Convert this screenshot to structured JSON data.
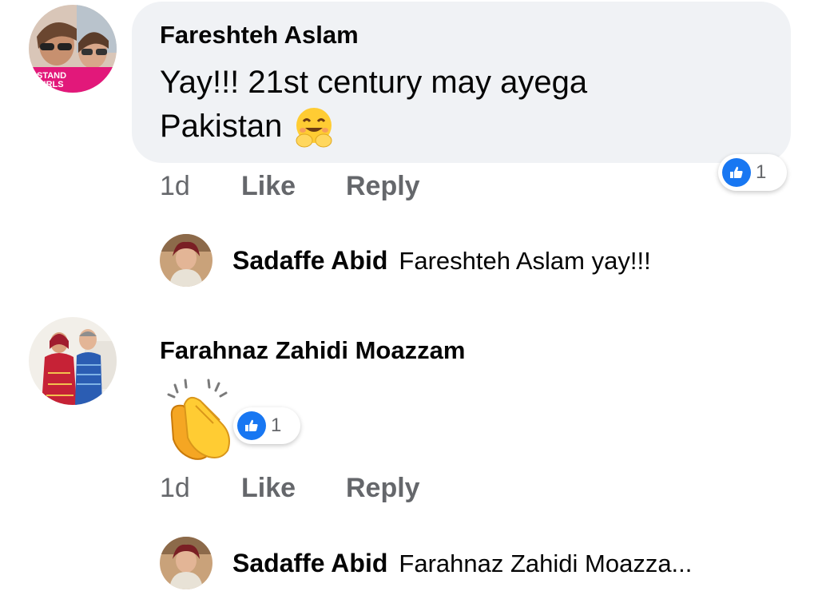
{
  "comments": [
    {
      "author": "Fareshteh Aslam",
      "text_line1": "Yay!!! 21st century may ayega",
      "text_line2": "Pakistan",
      "emoji": "smiling-face-with-open-hands",
      "avatar_caption": "STAND GIRLS",
      "time": "1d",
      "like_label": "Like",
      "reply_label": "Reply",
      "reaction_count": "1",
      "reply": {
        "author": "Sadaffe Abid",
        "text": "Fareshteh Aslam yay!!!"
      }
    },
    {
      "author": "Farahnaz Zahidi Moazzam",
      "emoji": "clapping-hands",
      "time": "1d",
      "like_label": "Like",
      "reply_label": "Reply",
      "reaction_count": "1",
      "reply": {
        "author": "Sadaffe Abid",
        "text": "Farahnaz Zahidi Moazza..."
      }
    }
  ],
  "colors": {
    "bubble_bg": "#f0f2f5",
    "meta_text": "#65676b",
    "like_blue": "#1877f2",
    "text": "#050505"
  }
}
